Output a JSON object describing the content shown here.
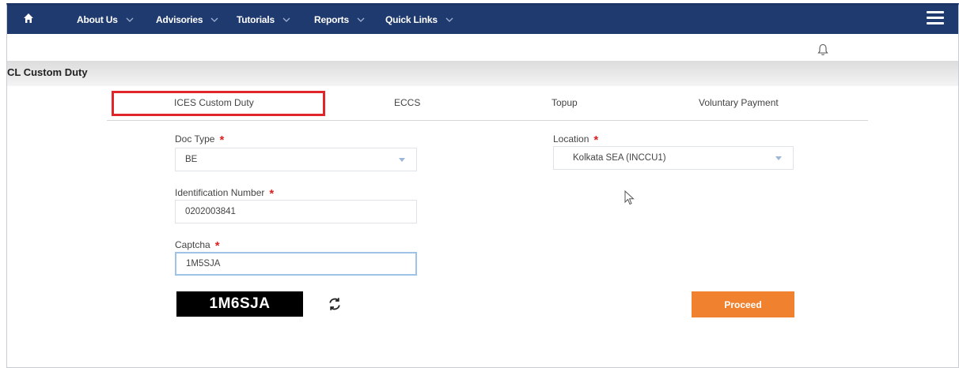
{
  "nav": {
    "home_icon": "home-icon",
    "items": [
      {
        "label": "About Us"
      },
      {
        "label": "Advisories"
      },
      {
        "label": "Tutorials"
      },
      {
        "label": "Reports"
      },
      {
        "label": "Quick Links"
      }
    ],
    "menu_icon": "hamburger-menu-icon"
  },
  "notifications": {
    "icon": "bell-icon"
  },
  "page": {
    "title": "CL Custom Duty"
  },
  "tabs": [
    {
      "label": "ICES Custom Duty",
      "active": true
    },
    {
      "label": "ECCS"
    },
    {
      "label": "Topup"
    },
    {
      "label": "Voluntary Payment"
    }
  ],
  "form": {
    "doc_type": {
      "label": "Doc Type",
      "required": "*",
      "value": "BE"
    },
    "location": {
      "label": "Location",
      "required": "*",
      "value": "Kolkata SEA (INCCU1)"
    },
    "identification": {
      "label": "Identification Number",
      "required": "*",
      "value": "0202003841"
    },
    "captcha": {
      "label": "Captcha",
      "required": "*",
      "value": "1M5SJA",
      "image_text": "1M6SJA"
    },
    "proceed_label": "Proceed"
  },
  "colors": {
    "nav_bg": "#1f3a6e",
    "active_tab_outline": "#e0262a",
    "proceed_bg": "#f0822f",
    "required": "#d22222"
  }
}
